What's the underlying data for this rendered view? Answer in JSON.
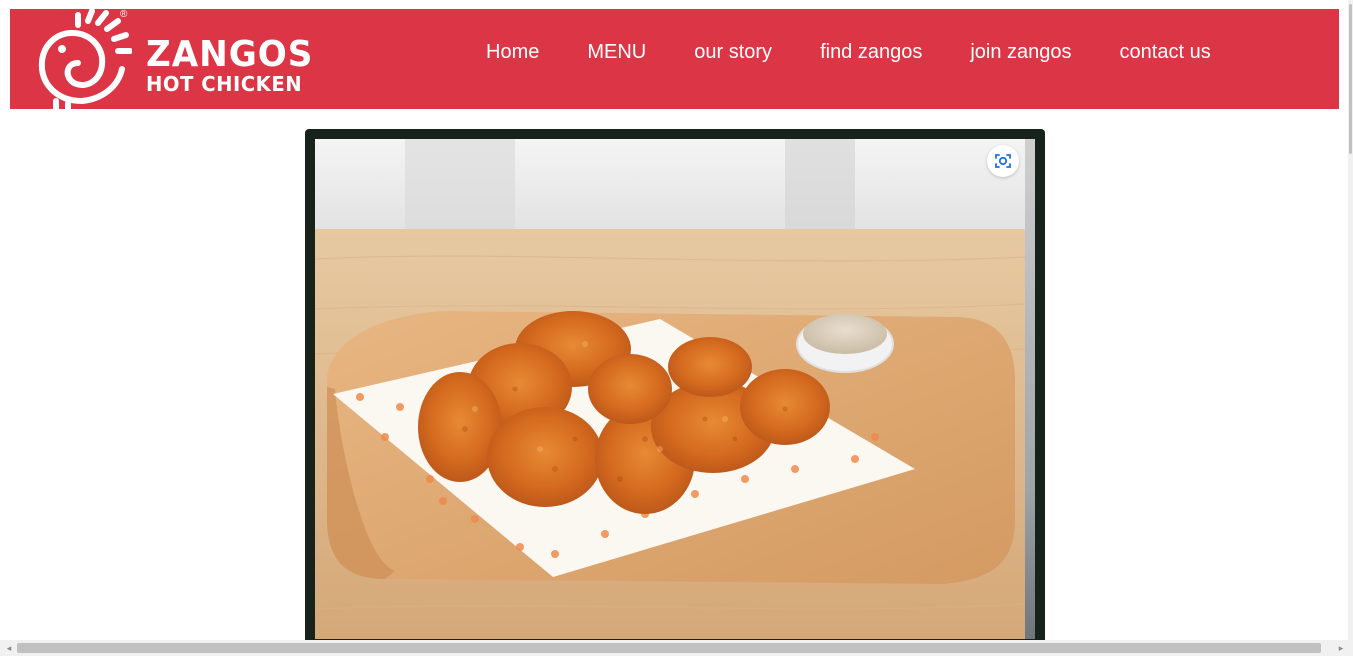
{
  "brand": {
    "name": "ZANGOS",
    "tagline": "HOT CHICKEN",
    "registered": "®",
    "color": "#dc3545"
  },
  "nav": {
    "items": [
      {
        "label": "Home"
      },
      {
        "label": "MENU"
      },
      {
        "label": "our story"
      },
      {
        "label": "find zangos"
      },
      {
        "label": "join zangos"
      },
      {
        "label": "contact us"
      }
    ]
  },
  "hero": {
    "frame_color": "#16221a",
    "lens_icon": "visual-search-icon"
  },
  "scrollbars": {
    "left_arrow": "◂",
    "right_arrow": "▸"
  }
}
